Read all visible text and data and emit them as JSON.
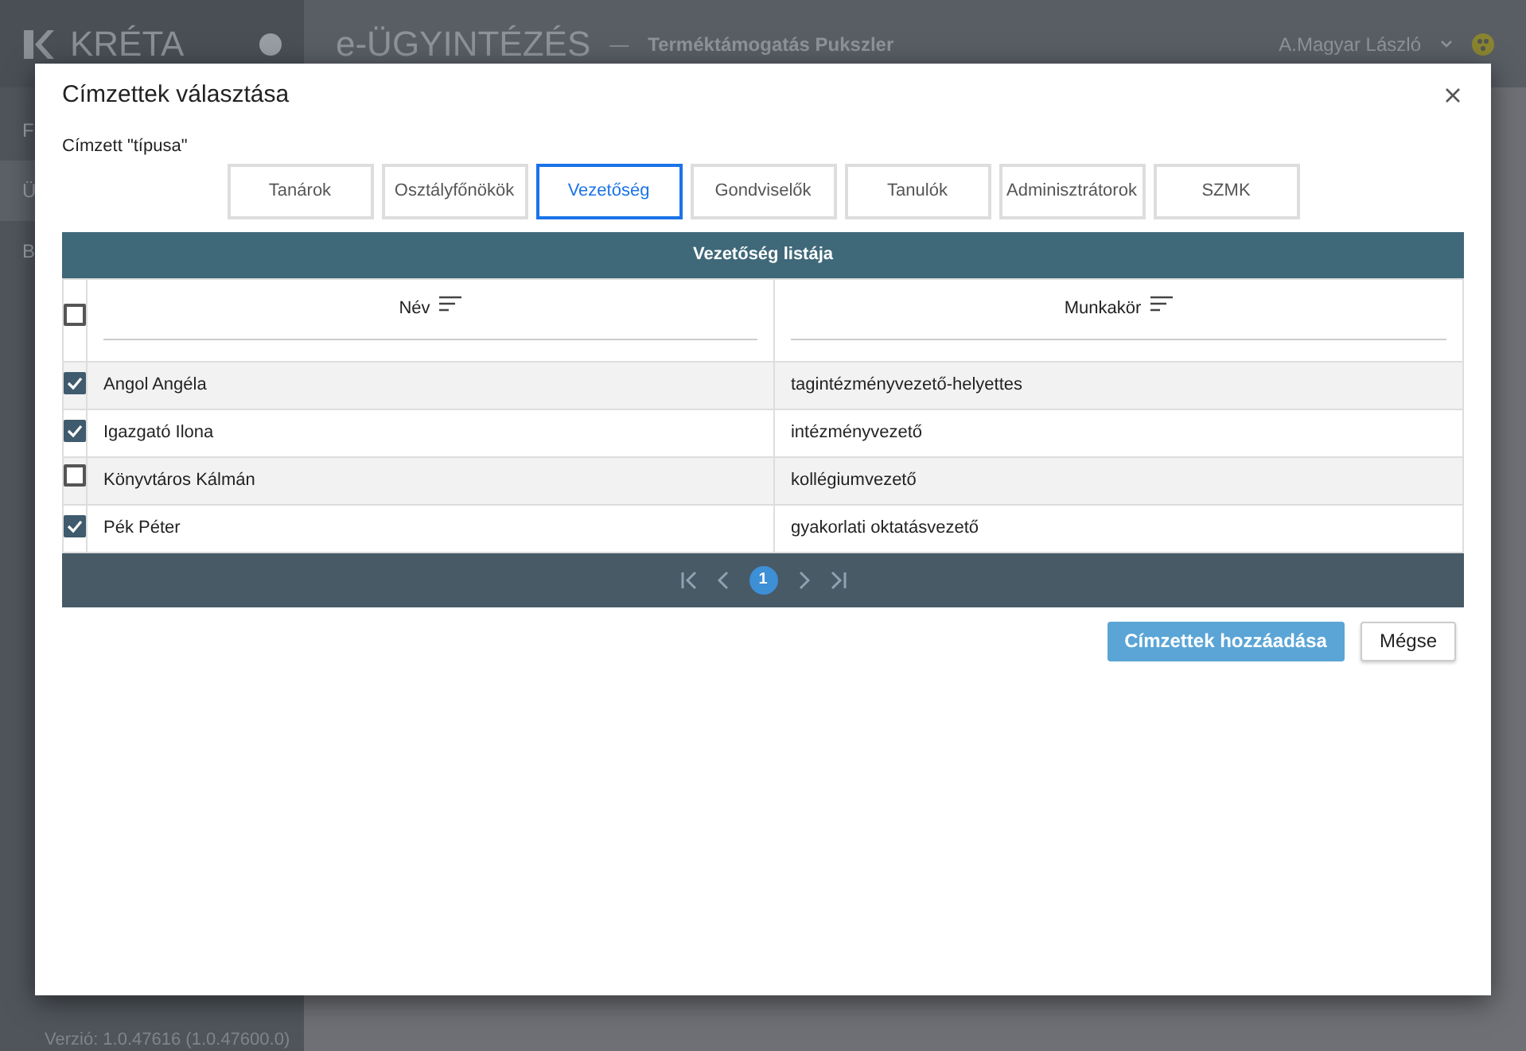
{
  "app": {
    "logo": "KRÉTA",
    "title": "e-ÜGYINTÉZÉS",
    "separator": "—",
    "subtitle": "Terméktámogatás Pukszler",
    "user": "A.Magyar László"
  },
  "sidebar": {
    "items": [
      {
        "label": "F",
        "selected": false
      },
      {
        "label": "Ü",
        "selected": true
      },
      {
        "label": "B",
        "selected": false
      }
    ],
    "version": "Verzió: 1.0.47616 (1.0.47600.0)"
  },
  "dialog": {
    "title": "Címzettek választása",
    "type_label": "Címzett \"típusa\"",
    "tabs": [
      {
        "label": "Tanárok",
        "selected": false
      },
      {
        "label": "Osztályfőnökök",
        "selected": false
      },
      {
        "label": "Vezetőség",
        "selected": true
      },
      {
        "label": "Gondviselők",
        "selected": false
      },
      {
        "label": "Tanulók",
        "selected": false
      },
      {
        "label": "Adminisztrátorok",
        "selected": false
      },
      {
        "label": "SZMK",
        "selected": false
      }
    ],
    "table": {
      "title": "Vezetőség listája",
      "all_checked": false,
      "columns": [
        "Név",
        "Munkakör"
      ],
      "rows": [
        {
          "checked": true,
          "cells": [
            "Angol Angéla",
            "tagintézményvezető-helyettes"
          ]
        },
        {
          "checked": true,
          "cells": [
            "Igazgató Ilona",
            "intézményvezető"
          ]
        },
        {
          "checked": false,
          "cells": [
            "Könyvtáros Kálmán",
            "kollégiumvezető"
          ]
        },
        {
          "checked": true,
          "cells": [
            "Pék Péter",
            "gyakorlati oktatásvezető"
          ]
        }
      ],
      "pages": [
        {
          "label": "1",
          "selected": true
        }
      ]
    },
    "buttons": [
      {
        "label": "Címzettek hozzáadása",
        "kind": "primary"
      },
      {
        "label": "Mégse",
        "kind": "secondary"
      }
    ]
  }
}
